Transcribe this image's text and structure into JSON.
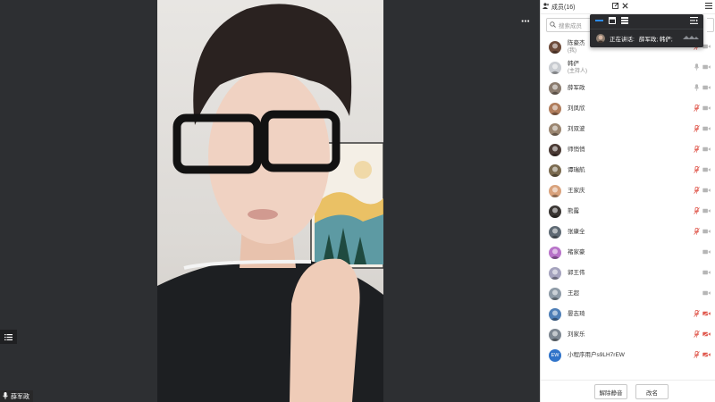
{
  "panel": {
    "title": "成员(16)",
    "search_placeholder": "搜索成员"
  },
  "speaking": {
    "label": "正在讲话:",
    "names": "薛军政; 韩俨;"
  },
  "video": {
    "speaker_name": "薛军政"
  },
  "members": [
    {
      "name": "陈豪杰",
      "role": "(我)",
      "mic": "muted",
      "cam": "off",
      "avatar_color": "#6d4b3a"
    },
    {
      "name": "韩俨",
      "role": "(主持人)",
      "mic": "on",
      "cam": "off",
      "avatar_color": "#c9ccd1"
    },
    {
      "name": "薛军政",
      "role": "",
      "mic": "on",
      "cam": "off",
      "avatar_color": "#8a7b6e"
    },
    {
      "name": "刘凤欣",
      "role": "",
      "mic": "muted",
      "cam": "off",
      "avatar_color": "#b07d5c"
    },
    {
      "name": "刘双波",
      "role": "",
      "mic": "muted",
      "cam": "off",
      "avatar_color": "#9a8570"
    },
    {
      "name": "师悄悄",
      "role": "",
      "mic": "muted",
      "cam": "off",
      "avatar_color": "#4a3a34"
    },
    {
      "name": "谭瑞航",
      "role": "",
      "mic": "muted",
      "cam": "off",
      "avatar_color": "#7a6a4f"
    },
    {
      "name": "王家庆",
      "role": "",
      "mic": "muted",
      "cam": "off",
      "avatar_color": "#d9a27c"
    },
    {
      "name": "熊露",
      "role": "",
      "mic": "muted",
      "cam": "off",
      "avatar_color": "#3a3633"
    },
    {
      "name": "张康全",
      "role": "",
      "mic": "muted",
      "cam": "off",
      "avatar_color": "#5f6a74"
    },
    {
      "name": "褚家豪",
      "role": "",
      "mic": "none",
      "cam": "off",
      "avatar_color": "#b873c9"
    },
    {
      "name": "郭王伟",
      "role": "",
      "mic": "none",
      "cam": "off",
      "avatar_color": "#a4a2bd"
    },
    {
      "name": "王超",
      "role": "",
      "mic": "none",
      "cam": "off",
      "avatar_color": "#8d9aa6"
    },
    {
      "name": "晏志琦",
      "role": "",
      "mic": "muted",
      "cam": "muted",
      "avatar_color": "#4f7fb7"
    },
    {
      "name": "刘家乐",
      "role": "",
      "mic": "muted",
      "cam": "muted",
      "avatar_color": "#7d8791"
    },
    {
      "name": "小程序用户s9LH7rEW",
      "role": "",
      "mic": "muted",
      "cam": "muted",
      "avatar_color": "#2f73c9",
      "avatar_text": "EW"
    }
  ],
  "footer": {
    "unmute_label": "解除静音",
    "rename_label": "改名"
  },
  "colors": {
    "muted_red": "#e05a4f",
    "icon_gray": "#b6b6b6",
    "accent_blue": "#2d8cf0"
  }
}
